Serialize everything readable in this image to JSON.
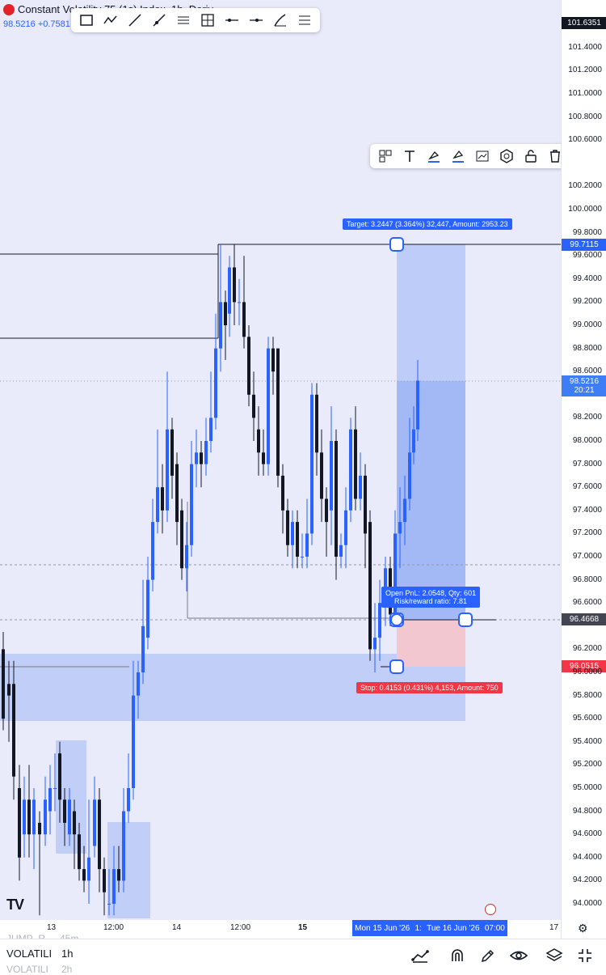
{
  "header": {
    "symbol_title": "Constant Volatility 75 (1s) Index, 1h, Deriv",
    "price": "98.5216",
    "change": "+0.7581"
  },
  "price_axis": {
    "ticks": [
      "101.4000",
      "101.2000",
      "101.0000",
      "100.8000",
      "100.6000",
      "100.2000",
      "100.0000",
      "99.8000",
      "99.6000",
      "99.4000",
      "99.2000",
      "99.0000",
      "98.8000",
      "98.6000",
      "98.2000",
      "98.0000",
      "97.8000",
      "97.6000",
      "97.4000",
      "97.2000",
      "97.0000",
      "96.8000",
      "96.6000",
      "96.2000",
      "96.0000",
      "95.8000",
      "95.6000",
      "95.4000",
      "95.2000",
      "95.0000",
      "94.8000",
      "94.6000",
      "94.4000",
      "94.2000",
      "94.0000"
    ],
    "top_label": "101.6351",
    "target_label": "99.7115",
    "last_price_label": "98.5216",
    "countdown": "20:21",
    "entry_label": "96.4668",
    "stop_label": "96.0515"
  },
  "time_axis": {
    "ticks": [
      "13",
      "12:00",
      "14",
      "12:00",
      "15",
      "17"
    ],
    "crosshair_left": "Mon 15 Jun '26",
    "crosshair_mid": "1:",
    "crosshair_right": "Tue 16 Jun '26",
    "crosshair_time": "07:00"
  },
  "position": {
    "target_text": "Target: 3.2447 (3.364%) 32,447, Amount: 2953.23",
    "open_pnl_text": "Open PnL: 2.0548, Qty: 601",
    "rr_text": "Risk/reward ratio: 7.81",
    "stop_text": "Stop: 0.4153 (0.431%) 4,153, Amount: 750"
  },
  "drawing_toolbar": {
    "icons": [
      "rectangle-icon",
      "path-icon",
      "trend-line-icon",
      "ray-icon",
      "parallel-channel-icon",
      "fib-grid-icon",
      "horizontal-ray-icon",
      "horizontal-line-icon",
      "brush-icon",
      "fib-retracement-icon"
    ]
  },
  "object_toolbar": {
    "icons": [
      "template-icon",
      "text-icon",
      "line-color-icon",
      "fill-color-icon",
      "chart-style-icon",
      "settings-icon",
      "lock-icon",
      "delete-icon",
      "more-icon"
    ]
  },
  "watermark": "TV",
  "side_list": [
    {
      "symbol": "JUMP_R",
      "value": "45m"
    },
    {
      "symbol": "VOLATILI",
      "value": "1h"
    },
    {
      "symbol": "VOLATILI",
      "value": "2h"
    }
  ],
  "colors": {
    "bull": "#2962ff",
    "bear": "#131722",
    "target_zone": "#b8c9f7",
    "stop_zone": "#f3c7d0",
    "target_tag": "#2962ff",
    "stop_tag": "#f23645",
    "last_price_tag": "#3d7df5"
  }
}
